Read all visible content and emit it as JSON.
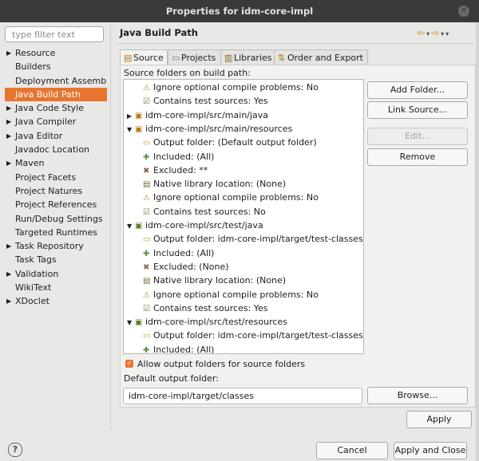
{
  "window": {
    "title": "Properties for idm-core-impl"
  },
  "filter": {
    "placeholder": "type filter text"
  },
  "tree": [
    {
      "label": "Resource",
      "twisty": true
    },
    {
      "label": "Builders",
      "twisty": false
    },
    {
      "label": "Deployment Assembly",
      "twisty": false
    },
    {
      "label": "Java Build Path",
      "twisty": false,
      "selected": true
    },
    {
      "label": "Java Code Style",
      "twisty": true
    },
    {
      "label": "Java Compiler",
      "twisty": true
    },
    {
      "label": "Java Editor",
      "twisty": true
    },
    {
      "label": "Javadoc Location",
      "twisty": false
    },
    {
      "label": "Maven",
      "twisty": true
    },
    {
      "label": "Project Facets",
      "twisty": false
    },
    {
      "label": "Project Natures",
      "twisty": false
    },
    {
      "label": "Project References",
      "twisty": false
    },
    {
      "label": "Run/Debug Settings",
      "twisty": false
    },
    {
      "label": "Targeted Runtimes",
      "twisty": false
    },
    {
      "label": "Task Repository",
      "twisty": true
    },
    {
      "label": "Task Tags",
      "twisty": false
    },
    {
      "label": "Validation",
      "twisty": true
    },
    {
      "label": "WikiText",
      "twisty": false
    },
    {
      "label": "XDoclet",
      "twisty": true
    }
  ],
  "page": {
    "title": "Java Build Path"
  },
  "tabs": [
    "Source",
    "Projects",
    "Libraries",
    "Order and Export"
  ],
  "source": {
    "list_label": "Source folders on build path:",
    "rows": [
      {
        "indent": 1,
        "icon": "warn",
        "text": "Ignore optional compile problems: No"
      },
      {
        "indent": 1,
        "icon": "test",
        "text": "Contains test sources: Yes"
      },
      {
        "indent": 0,
        "twisty": "▶",
        "icon": "pkg",
        "text": "idm-core-impl/src/main/java"
      },
      {
        "indent": 0,
        "twisty": "▼",
        "icon": "pkg",
        "text": "idm-core-impl/src/main/resources"
      },
      {
        "indent": 1,
        "icon": "folder",
        "text": "Output folder: (Default output folder)"
      },
      {
        "indent": 1,
        "icon": "incl",
        "text": "Included: (All)"
      },
      {
        "indent": 1,
        "icon": "excl",
        "text": "Excluded: **"
      },
      {
        "indent": 1,
        "icon": "lib",
        "text": "Native library location: (None)"
      },
      {
        "indent": 1,
        "icon": "warn",
        "text": "Ignore optional compile problems: No"
      },
      {
        "indent": 1,
        "icon": "test",
        "text": "Contains test sources: No"
      },
      {
        "indent": 0,
        "twisty": "▼",
        "icon": "pkgt",
        "text": "idm-core-impl/src/test/java"
      },
      {
        "indent": 1,
        "icon": "folder",
        "text": "Output folder: idm-core-impl/target/test-classes"
      },
      {
        "indent": 1,
        "icon": "incl",
        "text": "Included: (All)"
      },
      {
        "indent": 1,
        "icon": "excl",
        "text": "Excluded: (None)"
      },
      {
        "indent": 1,
        "icon": "lib",
        "text": "Native library location: (None)"
      },
      {
        "indent": 1,
        "icon": "warn",
        "text": "Ignore optional compile problems: No"
      },
      {
        "indent": 1,
        "icon": "test",
        "text": "Contains test sources: Yes"
      },
      {
        "indent": 0,
        "twisty": "▼",
        "icon": "pkgt",
        "text": "idm-core-impl/src/test/resources"
      },
      {
        "indent": 1,
        "icon": "folder",
        "text": "Output folder: idm-core-impl/target/test-classes"
      },
      {
        "indent": 1,
        "icon": "incl",
        "text": "Included: (All)"
      }
    ],
    "buttons": {
      "add": "Add Folder...",
      "link": "Link Source...",
      "edit": "Edit...",
      "remove": "Remove"
    },
    "allow_output": "Allow output folders for source folders",
    "default_output_label": "Default output folder:",
    "default_output_value": "idm-core-impl/target/classes",
    "browse": "Browse..."
  },
  "apply": "Apply",
  "cancel": "Cancel",
  "apply_close": "Apply and Close",
  "colors": {
    "accent": "#e8752f",
    "titlebar": "#3a3a38"
  }
}
